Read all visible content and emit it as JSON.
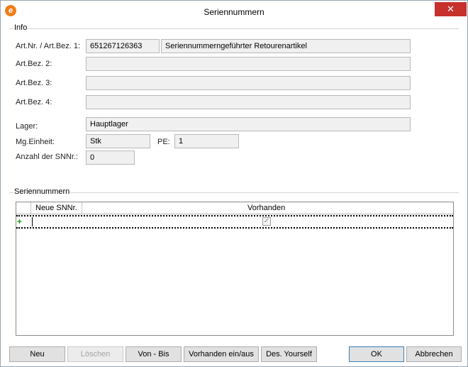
{
  "window": {
    "title": "Seriennummern",
    "close_label": "✕"
  },
  "info": {
    "group_label": "Info",
    "art_nr_label": "Art.Nr. / Art.Bez. 1:",
    "art_nr_value": "651267126363",
    "art_bez1_value": "Seriennummerngeführter Retourenartikel",
    "art_bez2_label": "Art.Bez. 2:",
    "art_bez2_value": "",
    "art_bez3_label": "Art.Bez. 3:",
    "art_bez3_value": "",
    "art_bez4_label": "Art.Bez. 4:",
    "art_bez4_value": "",
    "lager_label": "Lager:",
    "lager_value": "Hauptlager",
    "mg_einheit_label": "Mg.Einheit:",
    "mg_einheit_value": "Stk",
    "pe_label": "PE:",
    "pe_value": "1",
    "anzahl_label": "Anzahl der SNNr.:",
    "anzahl_value": "0"
  },
  "serials": {
    "group_label": "Seriennummern",
    "columns": [
      "Neue SNNr.",
      "Vorhanden"
    ],
    "new_row": {
      "snnr": "",
      "vorhanden_checked": true,
      "check_glyph": "✓",
      "indicator_glyph": "+"
    }
  },
  "buttons": {
    "neu": "Neu",
    "loeschen": "Löschen",
    "von_bis": "Von - Bis",
    "vorhanden": "Vorhanden ein/aus",
    "des_yourself": "Des. Yourself",
    "ok": "OK",
    "abbrechen": "Abbrechen"
  },
  "icons": {
    "app": "app-logo-icon",
    "close": "close-icon",
    "new_row": "new-row-plus-icon",
    "checkbox": "checkbox-checked-icon"
  },
  "colors": {
    "accent_close": "#c7312b",
    "app_icon": "#f07d1a",
    "new_row_plus": "#1a9c1a",
    "field_bg": "#f0f0f0"
  }
}
